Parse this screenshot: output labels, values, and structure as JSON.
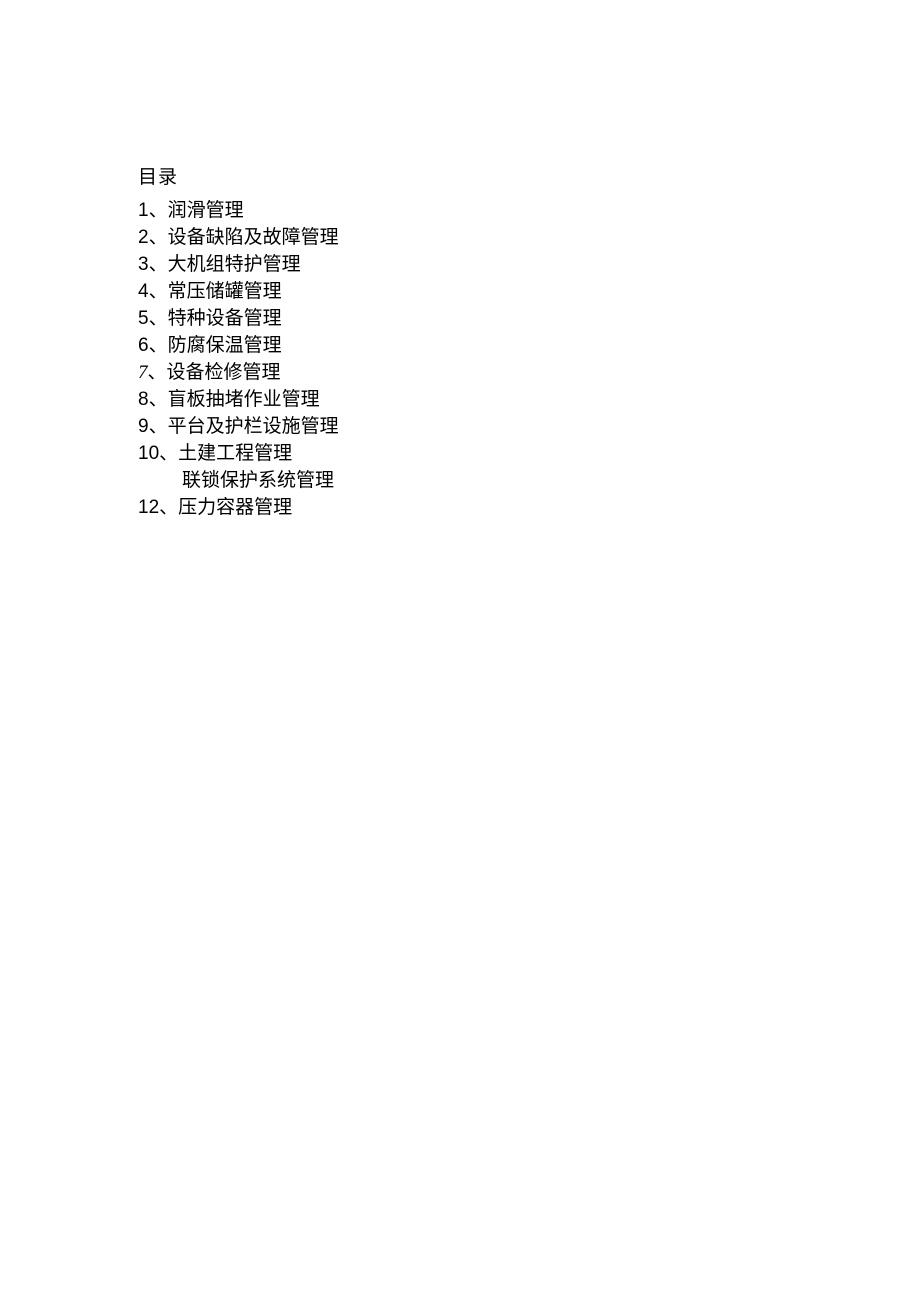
{
  "title": "目录",
  "items": [
    {
      "num": "1",
      "numClass": "num",
      "sep": "、",
      "label": "润滑管理"
    },
    {
      "num": "2",
      "numClass": "num",
      "sep": "、",
      "label": "设备缺陷及故障管理"
    },
    {
      "num": "3",
      "numClass": "num",
      "sep": "、",
      "label": "大机组特护管理"
    },
    {
      "num": "4",
      "numClass": "num",
      "sep": "、",
      "label": "常压储罐管理"
    },
    {
      "num": "5",
      "numClass": "num",
      "sep": "、",
      "label": "特种设备管理"
    },
    {
      "num": "6",
      "numClass": "num",
      "sep": "、",
      "label": "防腐保温管理"
    },
    {
      "num": "7",
      "numClass": "num-italic",
      "sep": "、",
      "label": "设备检修管理"
    },
    {
      "num": "8",
      "numClass": "num",
      "sep": "、",
      "label": "盲板抽堵作业管理"
    },
    {
      "num": "9",
      "numClass": "num",
      "sep": "、",
      "label": "平台及护栏设施管理"
    },
    {
      "num": "10",
      "numClass": "num",
      "sep": "、",
      "label": "土建工程管理"
    },
    {
      "num": "",
      "numClass": "num",
      "sep": "",
      "label": "联锁保护系统管理",
      "indent": true
    },
    {
      "num": "12",
      "numClass": "num",
      "sep": "、",
      "label": "压力容器管理"
    }
  ]
}
